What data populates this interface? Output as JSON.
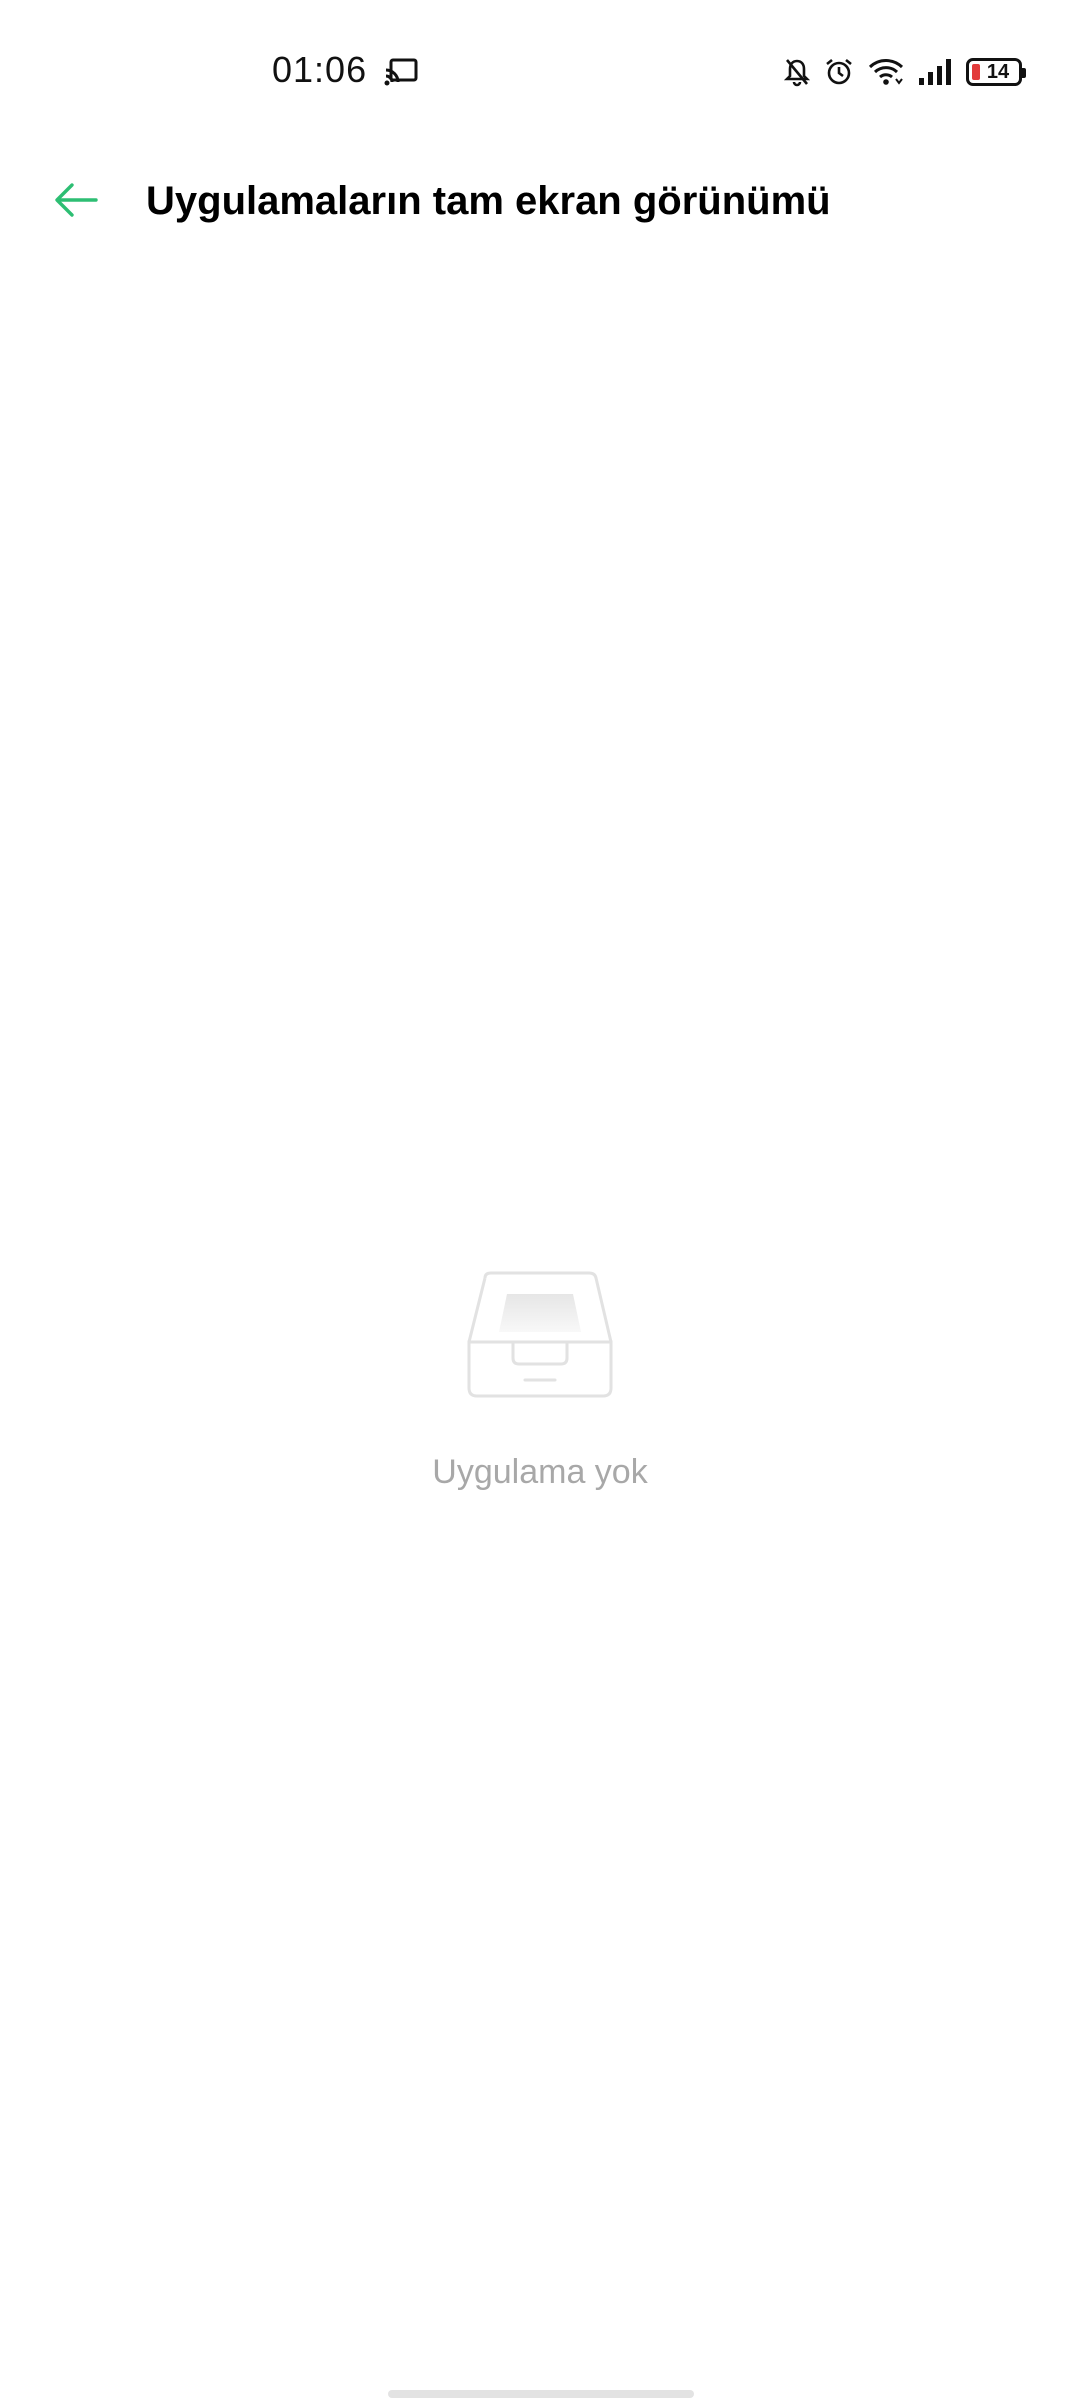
{
  "status_bar": {
    "time": "01:06",
    "battery_level": "14",
    "icons": [
      "cast-icon",
      "bell-muted-icon",
      "alarm-icon",
      "wifi-icon",
      "signal-icon",
      "battery-icon"
    ]
  },
  "header": {
    "back_icon": "arrow-left-icon",
    "title": "Uygulamaların tam ekran görünümü"
  },
  "empty_state": {
    "icon": "empty-tray-icon",
    "message": "Uygulama yok"
  },
  "colors": {
    "accent": "#2DBE73",
    "empty_text": "#A8A8A8",
    "battery_low": "#E23B3B"
  }
}
